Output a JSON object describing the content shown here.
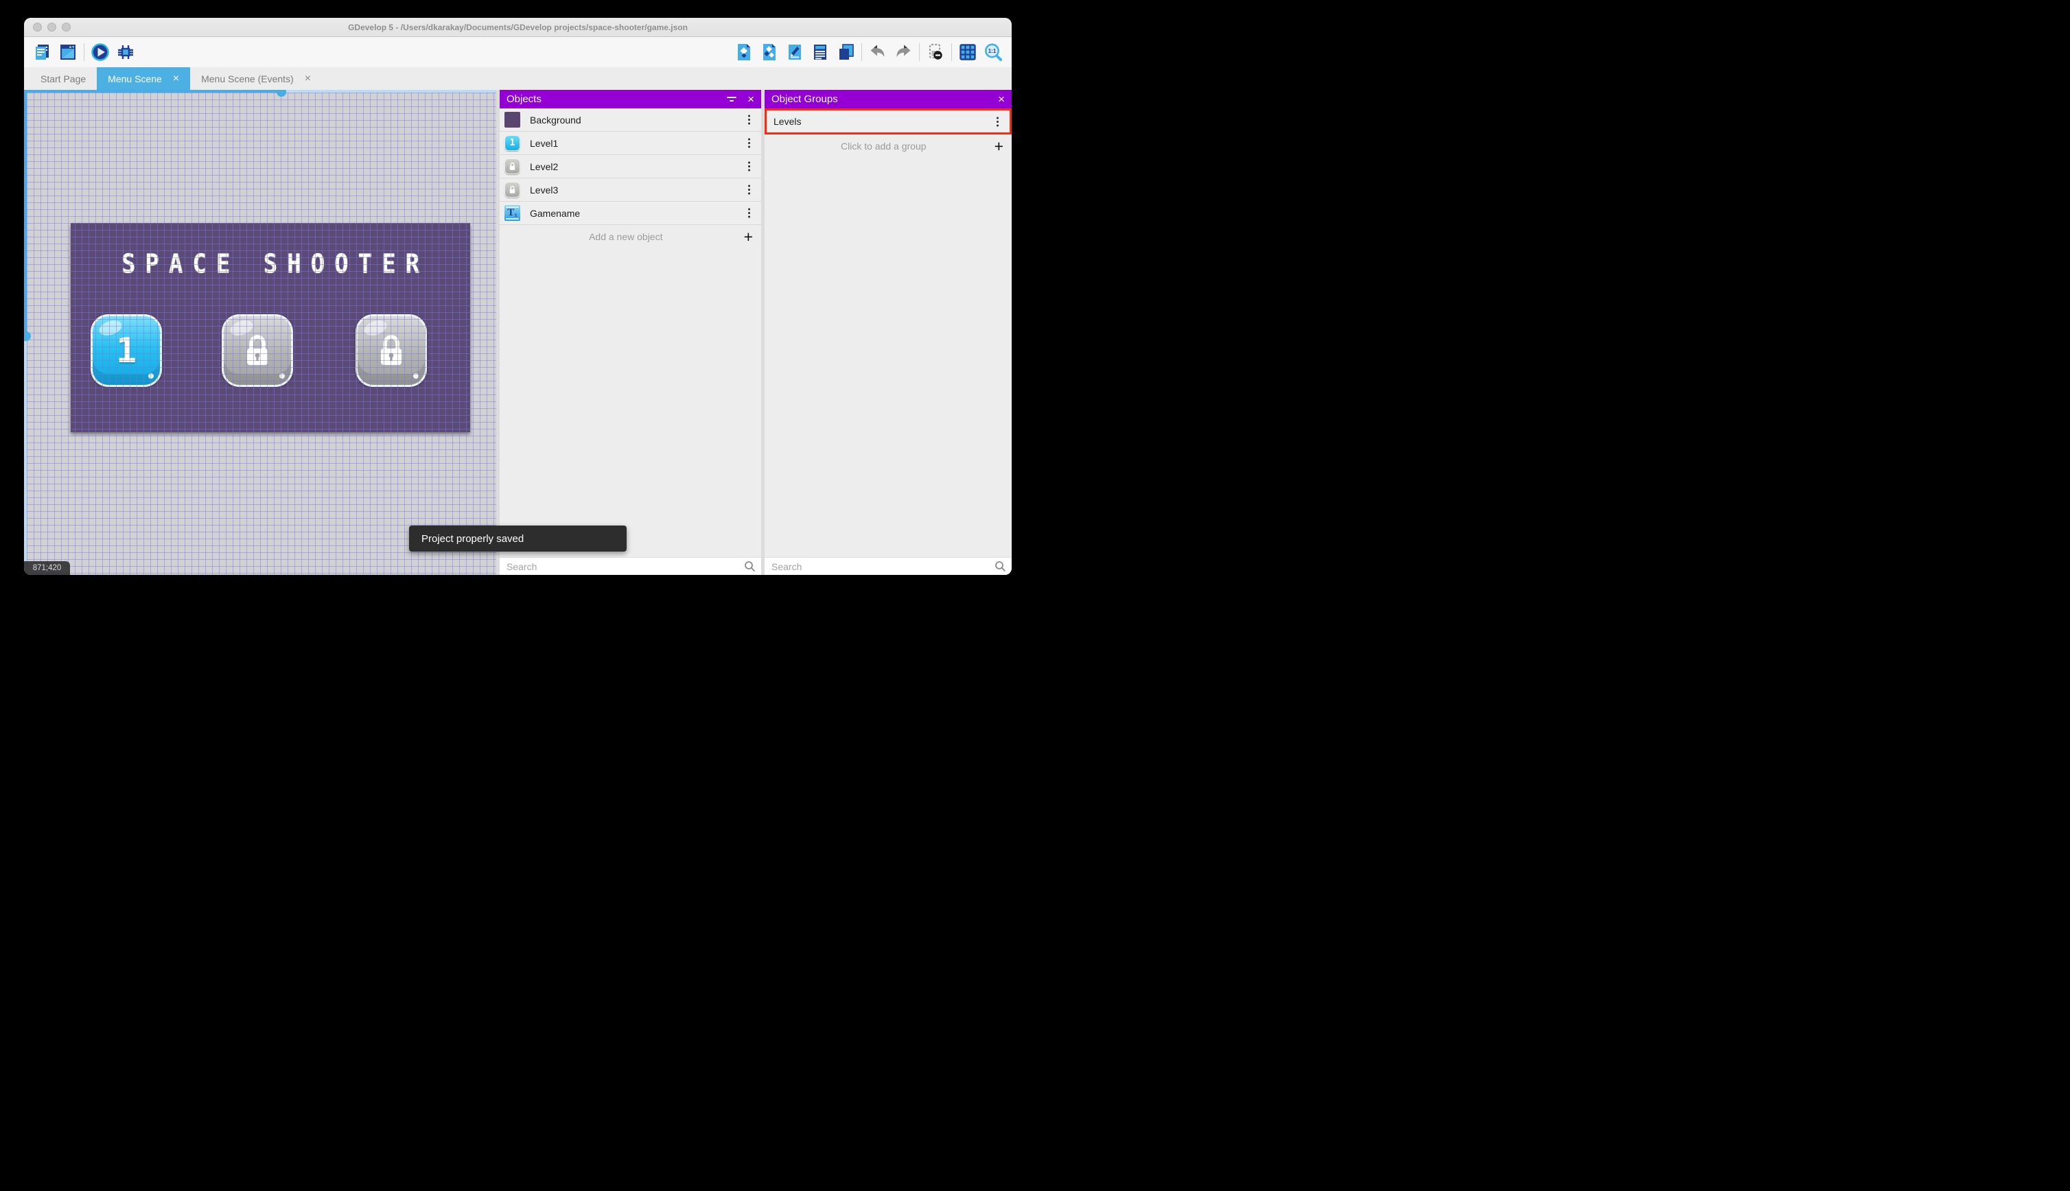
{
  "window": {
    "title": "GDevelop 5 - /Users/dkarakay/Documents/GDevelop projects/space-shooter/game.json",
    "traffic_lights": [
      "close",
      "minimize",
      "zoom"
    ]
  },
  "toolbar": {
    "left_icons": [
      "project-manager-icon",
      "scene-editor-icon",
      "play-icon",
      "debug-icon"
    ],
    "right_icons": [
      "objects-editor-icon",
      "object-groups-icon",
      "properties-icon",
      "instances-list-icon",
      "layers-icon",
      "undo-icon",
      "redo-icon",
      "window-mask-icon",
      "grid-icon",
      "zoom-1-1-icon"
    ]
  },
  "tabs": [
    {
      "label": "Start Page",
      "active": false,
      "closable": false
    },
    {
      "label": "Menu Scene",
      "active": true,
      "closable": true
    },
    {
      "label": "Menu Scene (Events)",
      "active": false,
      "closable": true
    }
  ],
  "canvas": {
    "scene_title": "SPACE SHOOTER",
    "coordinates": "871;420",
    "level_buttons": [
      {
        "label": "1",
        "state": "unlocked"
      },
      {
        "label": "",
        "state": "locked"
      },
      {
        "label": "",
        "state": "locked"
      }
    ]
  },
  "objects_panel": {
    "title": "Objects",
    "items": [
      {
        "name": "Background",
        "icon": "background-swatch"
      },
      {
        "name": "Level1",
        "icon": "level1-button-thumbnail"
      },
      {
        "name": "Level2",
        "icon": "locked-button-thumbnail"
      },
      {
        "name": "Level3",
        "icon": "locked-button-thumbnail"
      },
      {
        "name": "Gamename",
        "icon": "text-object-thumbnail"
      }
    ],
    "add_label": "Add a new object",
    "search_placeholder": "Search"
  },
  "groups_panel": {
    "title": "Object Groups",
    "items": [
      {
        "name": "Levels",
        "highlighted": true
      }
    ],
    "add_label": "Click to add a group",
    "search_placeholder": "Search"
  },
  "toast": {
    "message": "Project properly saved"
  },
  "colors": {
    "accent_blue": "#4cb0e2",
    "header_purple": "#9400d3",
    "annotation_red": "#ff2912",
    "scene_purple": "#5b4a74",
    "toast_bg": "#2d2d2d"
  }
}
